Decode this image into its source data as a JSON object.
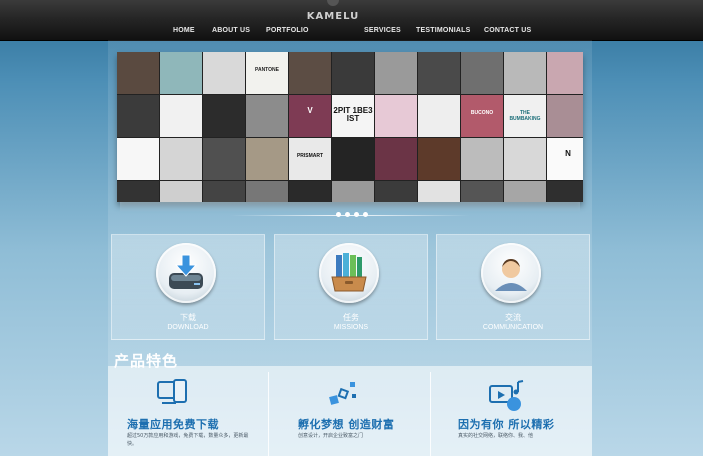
{
  "logo": {
    "text": "KAMELU"
  },
  "nav": {
    "items": [
      {
        "label": "HOME"
      },
      {
        "label": "ABOUT US"
      },
      {
        "label": "PORTFOLIO"
      },
      {
        "label": "SERVICES"
      },
      {
        "label": "TESTIMONIALS"
      },
      {
        "label": "CONTACT US"
      }
    ]
  },
  "collage": {
    "labels": {
      "pantone": "PANTONE",
      "twist": "2PIT 1BE3 IST",
      "bucono": "BUCONO",
      "bumbaking": "THE BUMBAKING",
      "n": "N",
      "v": "V",
      "prismart": "PRISMART"
    }
  },
  "slider": {
    "dots": 4
  },
  "cards": [
    {
      "cn": "下载",
      "en": "DOWNLOAD",
      "icon": "download-drive-icon"
    },
    {
      "cn": "任务",
      "en": "MISSIONS",
      "icon": "folder-binders-icon"
    },
    {
      "cn": "交流",
      "en": "COMMUNICATION",
      "icon": "user-avatar-icon"
    }
  ],
  "section": {
    "title": "产品特色"
  },
  "features": [
    {
      "title": "海量应用免费下载",
      "desc": "超过50万款应用和游戏，免费下载，数量众多，更新最快。",
      "icon": "devices-icon"
    },
    {
      "title": "孵化梦想 创造财富",
      "desc": "创意设计，开启企业致富之门",
      "icon": "blocks-icon"
    },
    {
      "title": "因为有你 所以精彩",
      "desc": "真实的社交网络，联络你、我、他",
      "icon": "media-icon"
    }
  ],
  "colors": {
    "accent": "#1d6fb0",
    "topbar": "#1f1f1f"
  }
}
